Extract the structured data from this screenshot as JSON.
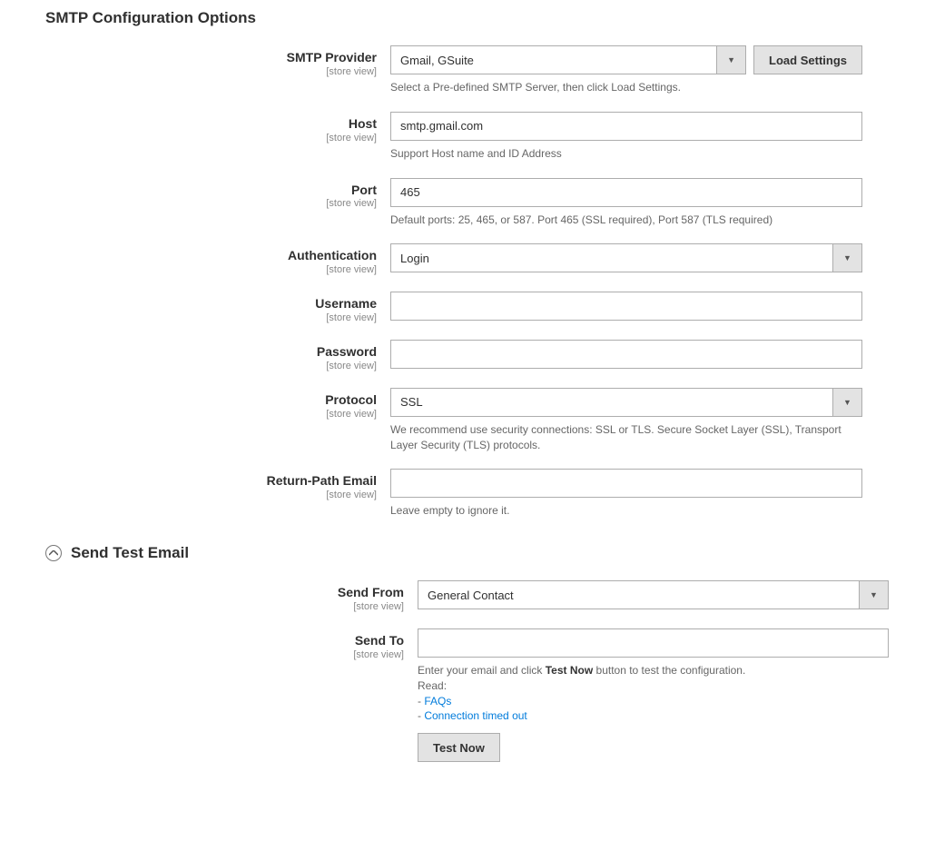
{
  "sections": {
    "smtp": {
      "title": "SMTP Configuration Options"
    },
    "test": {
      "title": "Send Test Email"
    }
  },
  "scope_label": "[store view]",
  "fields": {
    "provider": {
      "label": "SMTP Provider",
      "value": "Gmail, GSuite",
      "help": "Select a Pre-defined SMTP Server, then click Load Settings.",
      "button": "Load Settings"
    },
    "host": {
      "label": "Host",
      "value": "smtp.gmail.com",
      "help": "Support Host name and ID Address"
    },
    "port": {
      "label": "Port",
      "value": "465",
      "help": "Default ports: 25, 465, or 587. Port 465 (SSL required), Port 587 (TLS required)"
    },
    "authentication": {
      "label": "Authentication",
      "value": "Login"
    },
    "username": {
      "label": "Username",
      "value": ""
    },
    "password": {
      "label": "Password",
      "value": ""
    },
    "protocol": {
      "label": "Protocol",
      "value": "SSL",
      "help": "We recommend use security connections: SSL or TLS. Secure Socket Layer (SSL), Transport Layer Security (TLS) protocols."
    },
    "return_path": {
      "label": "Return-Path Email",
      "value": "",
      "help": "Leave empty to ignore it."
    },
    "send_from": {
      "label": "Send From",
      "value": "General Contact"
    },
    "send_to": {
      "label": "Send To",
      "value": "",
      "help_prefix": "Enter your email and click ",
      "help_strong": "Test Now",
      "help_suffix": " button to test the configuration.",
      "read_label": "Read:",
      "faq_prefix": "- ",
      "faq_link": "FAQs",
      "timeout_prefix": "- ",
      "timeout_link": "Connection timed out"
    }
  },
  "buttons": {
    "test_now": "Test Now"
  }
}
